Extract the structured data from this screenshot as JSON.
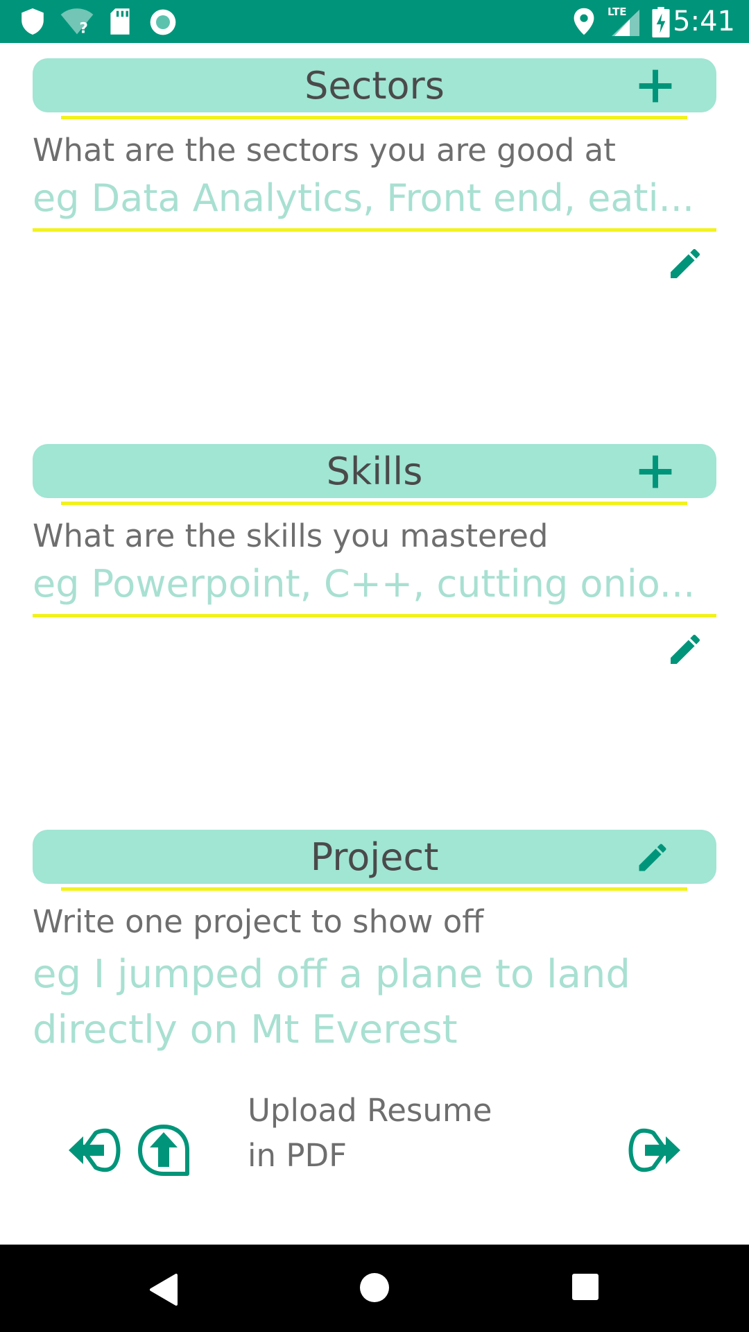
{
  "status_bar": {
    "time": "5:41",
    "network": "LTE",
    "icons": [
      "shield-icon",
      "wifi-question-icon",
      "sd-card-icon",
      "record-icon",
      "location-icon",
      "lte-signal-icon",
      "battery-charging-icon"
    ]
  },
  "sections": {
    "sectors": {
      "title": "Sectors",
      "question": "What are the sectors you are good at",
      "placeholder": "eg Data Analytics, Front end, eati..."
    },
    "skills": {
      "title": "Skills",
      "question": "What are the skills you mastered",
      "placeholder": "eg Powerpoint, C++, cutting onio..."
    },
    "project": {
      "title": "Project",
      "question": "Write one project to show off",
      "placeholder": "eg I jumped off a plane to land directly on Mt Everest"
    }
  },
  "footer": {
    "upload_line1": "Upload Resume",
    "upload_line2": "in PDF"
  },
  "colors": {
    "accent": "#00957a",
    "header_bg": "#a1e5d3",
    "underline": "#f2f21c",
    "hint": "#a8e0d1"
  }
}
